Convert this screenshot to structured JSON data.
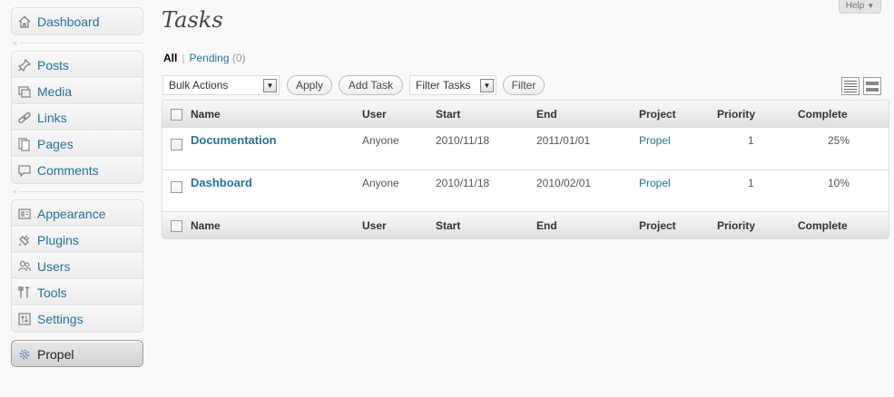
{
  "help": {
    "label": "Help"
  },
  "page": {
    "title": "Tasks"
  },
  "sidebar": {
    "group1": [
      {
        "label": "Dashboard",
        "icon": "home-icon"
      }
    ],
    "group2": [
      {
        "label": "Posts",
        "icon": "pushpin-icon"
      },
      {
        "label": "Media",
        "icon": "media-icon"
      },
      {
        "label": "Links",
        "icon": "link-icon"
      },
      {
        "label": "Pages",
        "icon": "pages-icon"
      },
      {
        "label": "Comments",
        "icon": "comment-icon"
      }
    ],
    "group3": [
      {
        "label": "Appearance",
        "icon": "appearance-icon"
      },
      {
        "label": "Plugins",
        "icon": "plugin-icon"
      },
      {
        "label": "Users",
        "icon": "users-icon"
      },
      {
        "label": "Tools",
        "icon": "tools-icon"
      },
      {
        "label": "Settings",
        "icon": "settings-icon"
      }
    ],
    "group4": [
      {
        "label": "Propel",
        "icon": "propel-gear-icon"
      }
    ]
  },
  "filters": {
    "all": "All",
    "separator": "|",
    "pending": "Pending",
    "pending_count": "(0)"
  },
  "toolbar": {
    "bulk_actions": "Bulk Actions",
    "apply": "Apply",
    "add_task": "Add Task",
    "filter_tasks": "Filter Tasks",
    "filter": "Filter"
  },
  "table": {
    "columns": [
      "Name",
      "User",
      "Start",
      "End",
      "Project",
      "Priority",
      "Complete"
    ],
    "rows": [
      {
        "name": "Documentation",
        "user": "Anyone",
        "start": "2010/11/18",
        "end": "2011/01/01",
        "project": "Propel",
        "priority": "1",
        "complete": "25%"
      },
      {
        "name": "Dashboard",
        "user": "Anyone",
        "start": "2010/11/18",
        "end": "2010/02/01",
        "project": "Propel",
        "priority": "1",
        "complete": "10%"
      }
    ]
  },
  "colors": {
    "link": "#21759b",
    "heading": "#464646",
    "background": "#f9f9f9"
  }
}
